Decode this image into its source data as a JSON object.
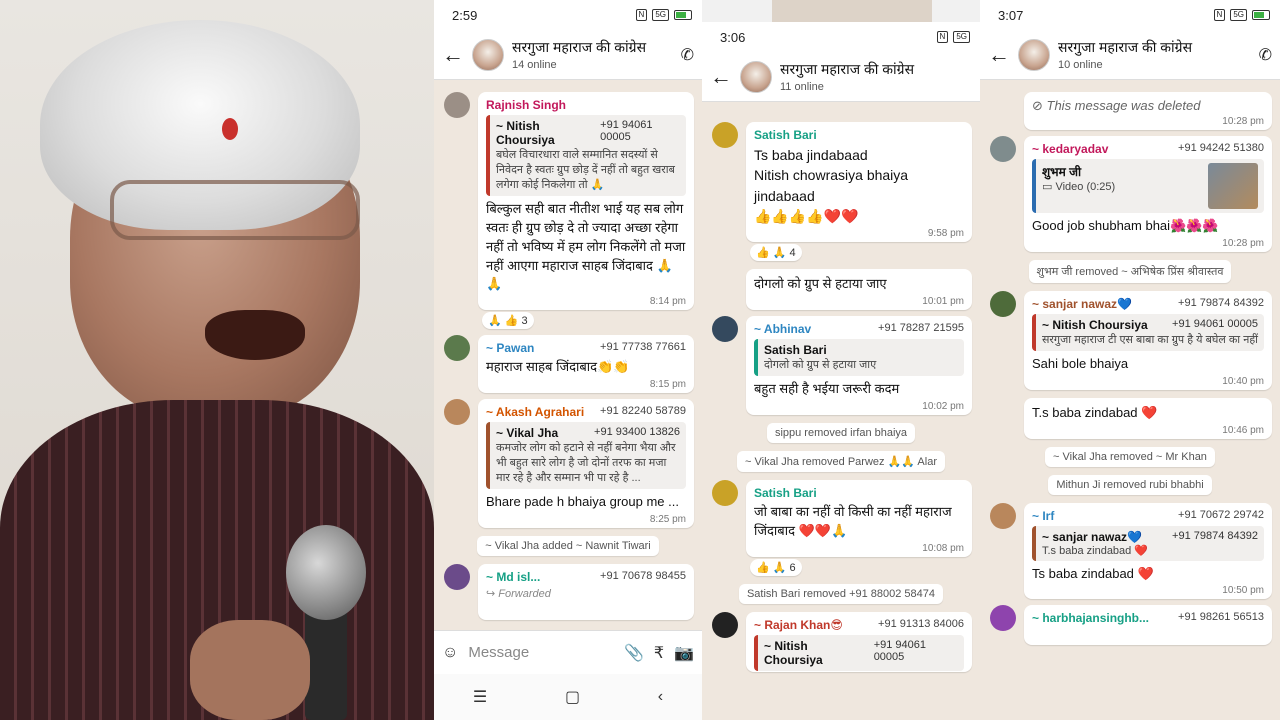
{
  "phone1": {
    "status_time": "2:59",
    "group_name": "सरगुजा महाराज की कांग्रेस",
    "online": "14 online",
    "messages": [
      {
        "sender": "Rajnish Singh",
        "phone": "",
        "quote_sender": "~ Nitish Choursiya",
        "quote_phone": "+91 94061 00005",
        "quote_text": "बघेल विचारधारा वाले सम्मानित सदस्यों से निवेदन है स्वतः ग्रुप छोड़ दें नहीं तो बहुत खराब लगेगा कोई निकलेगा तो 🙏",
        "text": "बिल्कुल सही बात नीतीश भाई यह सब लोग स्वतः ही ग्रुप छोड़ दे तो ज्यादा अच्छा रहेगा नहीं तो भविष्य में हम लोग निकलेंगे तो मजा नहीं आएगा महाराज साहब जिंदाबाद 🙏🙏",
        "time": "8:14 pm",
        "reactions": "🙏 👍 3"
      },
      {
        "sender": "~ Pawan",
        "phone": "+91 77738 77661",
        "text": "महाराज साहब जिंदाबाद👏👏",
        "time": "8:15 pm"
      },
      {
        "sender": "~ Akash Agrahari",
        "phone": "+91 82240 58789",
        "quote_sender": "~ Vikal Jha",
        "quote_phone": "+91 93400 13826",
        "quote_text": "कमजोर लोग को हटाने से नहीं बनेगा भैया और भी बहुत सारे लोग है जो दोनों तरफ का मजा मार रहे है और सम्मान भी पा रहे है ...",
        "text": "Bhare pade h bhaiya group me ...",
        "time": "8:25 pm"
      }
    ],
    "system1": "~ Vikal Jha added ~ Nawnit Tiwari",
    "last_sender": "~ Md isl...",
    "last_phone": "+91 70678 98455",
    "forwarded": "Forwarded",
    "composer_placeholder": "Message"
  },
  "phone2": {
    "status_time": "3:06",
    "group_name": "सरगुजा महाराज की कांग्रेस",
    "online": "11 online",
    "messages": [
      {
        "sender": "Satish Bari",
        "text": "Ts baba jindabaad\nNitish chowrasiya bhaiya jindabaad\n👍👍👍👍❤️❤️",
        "time": "9:58 pm",
        "reactions": "👍 🙏 4"
      },
      {
        "sender": "",
        "text": "दोगलो को ग्रुप से हटाया जाए",
        "time": "10:01 pm"
      },
      {
        "sender": "~ Abhinav",
        "phone": "+91 78287 21595",
        "quote_sender": "Satish Bari",
        "quote_text": "दोगलो को ग्रुप से हटाया जाए",
        "text": "बहुत सही है भईया जरूरी कदम",
        "time": "10:02 pm"
      }
    ],
    "system1": "sippu removed irfan bhaiya",
    "system2": "~ Vikal Jha removed Parwez 🙏🙏 Alar",
    "msg4_sender": "Satish Bari",
    "msg4_text": "जो बाबा का नहीं वो किसी का नहीं महाराज जिंदाबाद ❤️❤️🙏",
    "msg4_time": "10:08 pm",
    "msg4_reactions": "👍 🙏 6",
    "system3": "Satish Bari removed +91 88002 58474",
    "msg5_sender": "~ Rajan Khan😎",
    "msg5_phone": "+91 91313 84006",
    "msg5_quote_sender": "~ Nitish Choursiya",
    "msg5_quote_phone": "+91 94061 00005"
  },
  "phone3": {
    "status_time": "3:07",
    "group_name": "सरगुजा महाराज की कांग्रेस",
    "online": "10 online",
    "deleted_text": "This message was deleted",
    "deleted_time": "10:28 pm",
    "m1_sender": "~ kedaryadav",
    "m1_phone": "+91 94242 51380",
    "m1_quote_sender": "शुभम जी",
    "m1_quote_text": "Video (0:25)",
    "m1_text": "Good job shubham bhai🌺🌺🌺",
    "m1_time": "10:28 pm",
    "system1": "शुभम जी removed ~ अभिषेक प्रिंस श्रीवास्तव",
    "m2_sender": "~ sanjar nawaz💙",
    "m2_phone": "+91 79874 84392",
    "m2_quote_sender": "~ Nitish Choursiya",
    "m2_quote_phone": "+91 94061 00005",
    "m2_quote_text": "सरगुजा महाराज टी एस बाबा का ग्रुप है ये बघेल का नहीं",
    "m2_text": "Sahi bole bhaiya",
    "m2_time": "10:40 pm",
    "m3_text": "T.s baba zindabad ❤️",
    "m3_time": "10:46 pm",
    "system2": "~ Vikal Jha removed ~ Mr Khan",
    "system3": "Mithun Ji removed rubi bhabhi",
    "m4_sender": "~ Irf",
    "m4_phone": "+91 70672 29742",
    "m4_quote_sender": "~ sanjar nawaz💙",
    "m4_quote_phone": "+91 79874 84392",
    "m4_quote_text": "T.s baba zindabad ❤️",
    "m4_text": "Ts baba zindabad ❤️",
    "m4_time": "10:50 pm",
    "m5_sender": "~ harbhajansinghb...",
    "m5_phone": "+91 98261 56513"
  },
  "icons": {
    "back": "←",
    "attach": "📎",
    "rupee": "₹",
    "camera": "📷",
    "emoji": "☺"
  }
}
